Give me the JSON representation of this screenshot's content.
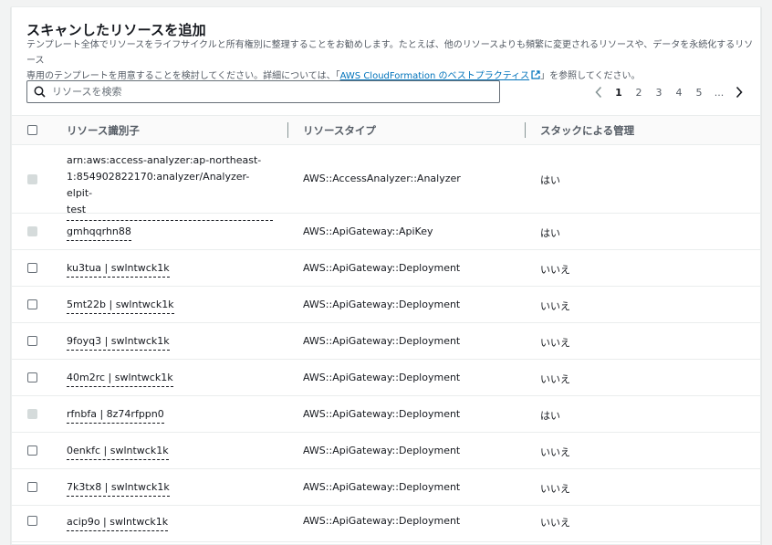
{
  "section": {
    "title": "スキャンしたリソースを追加",
    "description_line1": "テンプレート全体でリソースをライフサイクルと所有権別に整理することをお勧めします。たとえば、他のリソースよりも頻繁に変更されるリソースや、データを永続化するリソース",
    "description_line2_pre": "専用のテンプレートを用意することを検討してください。詳細については、「",
    "description_link": "AWS CloudFormation のベストプラクティス",
    "description_line2_post": "」を参照してください。"
  },
  "search": {
    "placeholder": "リソースを検索",
    "value": ""
  },
  "pagination": {
    "pages": [
      "1",
      "2",
      "3",
      "4",
      "5",
      "..."
    ],
    "current": "1"
  },
  "table": {
    "headers": {
      "identifier": "リソース識別子",
      "type": "リソースタイプ",
      "managed": "スタックによる管理"
    },
    "rows": [
      {
        "id_lines": [
          "arn:aws:access-analyzer:ap-northeast-",
          "1:854902822170:analyzer/Analyzer-elpit-",
          "test"
        ],
        "type": "AWS::AccessAnalyzer::Analyzer",
        "managed": "はい",
        "selectable": false
      },
      {
        "id": "gmhqqrhn88",
        "type": "AWS::ApiGateway::ApiKey",
        "managed": "はい",
        "selectable": false
      },
      {
        "id": "ku3tua | swlntwck1k",
        "type": "AWS::ApiGateway::Deployment",
        "managed": "いいえ",
        "selectable": true
      },
      {
        "id": "5mt22b | swlntwck1k",
        "type": "AWS::ApiGateway::Deployment",
        "managed": "いいえ",
        "selectable": true
      },
      {
        "id": "9foyq3 | swlntwck1k",
        "type": "AWS::ApiGateway::Deployment",
        "managed": "いいえ",
        "selectable": true
      },
      {
        "id": "40m2rc | swlntwck1k",
        "type": "AWS::ApiGateway::Deployment",
        "managed": "いいえ",
        "selectable": true
      },
      {
        "id": "rfnbfa | 8z74rfppn0",
        "type": "AWS::ApiGateway::Deployment",
        "managed": "はい",
        "selectable": false
      },
      {
        "id": "0enkfc | swlntwck1k",
        "type": "AWS::ApiGateway::Deployment",
        "managed": "いいえ",
        "selectable": true
      },
      {
        "id": "7k3tx8 | swlntwck1k",
        "type": "AWS::ApiGateway::Deployment",
        "managed": "いいえ",
        "selectable": true
      },
      {
        "id": "acip9o | swlntwck1k",
        "type": "AWS::ApiGateway::Deployment",
        "managed": "いいえ",
        "selectable": true
      }
    ]
  },
  "icons": {
    "search": "search-icon",
    "external_link": "external-link-icon",
    "prev": "chevron-left-icon",
    "next": "chevron-right-icon"
  },
  "colors": {
    "link": "#0073bb",
    "text": "#16191f",
    "muted": "#545b64"
  }
}
